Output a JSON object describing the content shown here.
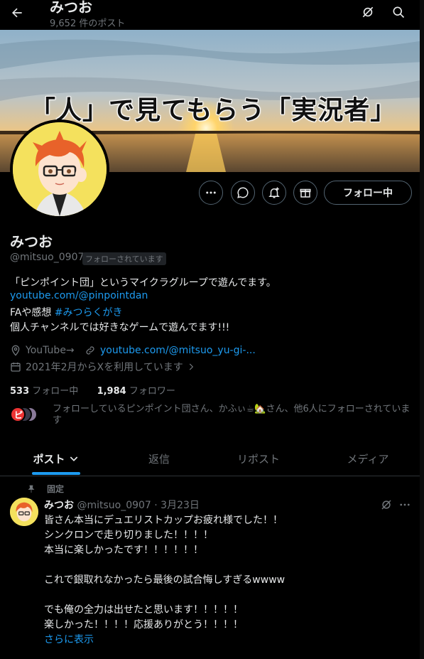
{
  "header": {
    "title": "みつお",
    "post_count": "9,652 件のポスト"
  },
  "banner": {
    "text": "「人」で見てもらう「実況者」"
  },
  "profile": {
    "follow_button": "フォロー中",
    "name": "みつお",
    "handle": "@mitsuo_0907",
    "followed_badge": "フォローされています",
    "bio_line1": "「ピンポイント団」というマイクラグループで遊んでます。",
    "bio_link": "youtube.com/@pinpointdan",
    "bio_line3_text": "FAや感想 ",
    "bio_hashtag": "#みつらくがき",
    "bio_line4": "個人チャンネルでは好きなゲームで遊んでます!!!",
    "location": "YouTube→",
    "website": "youtube.com/@mitsuo_yu-gi-...",
    "joined": "2021年2月からXを利用しています",
    "following_count": "533",
    "following_label": "フォロー中",
    "followers_count": "1,984",
    "followers_label": "フォロワー",
    "followed_by": "フォローしているピンポイント団さん、かふぃ☕🏡さん、他6人にフォローされています",
    "mini_avatar_1_letter": "ピ"
  },
  "tabs": [
    {
      "label": "ポスト"
    },
    {
      "label": "返信"
    },
    {
      "label": "リポスト"
    },
    {
      "label": "メディア"
    }
  ],
  "pinned_post": {
    "pinned_label": "固定",
    "name": "みつお",
    "handle_date": "@mitsuo_0907 · 3月23日",
    "body": "皆さん本当にデュエリストカップお疲れ様でした！！\nシンクロンで走り切りました！！！！\n本当に楽しかったです！！！！！！\n\nこれで銀取れなかったら最後の試合悔しすぎるwwww\n\nでも俺の全力は出せたと思います！！！！！\n楽しかった！！！！応援ありがとう！！！！",
    "show_more": "さらに表示"
  },
  "colors": {
    "accent": "#1d9bf0",
    "muted": "#71767b",
    "text": "#e7e9ea",
    "border": "#536471"
  }
}
